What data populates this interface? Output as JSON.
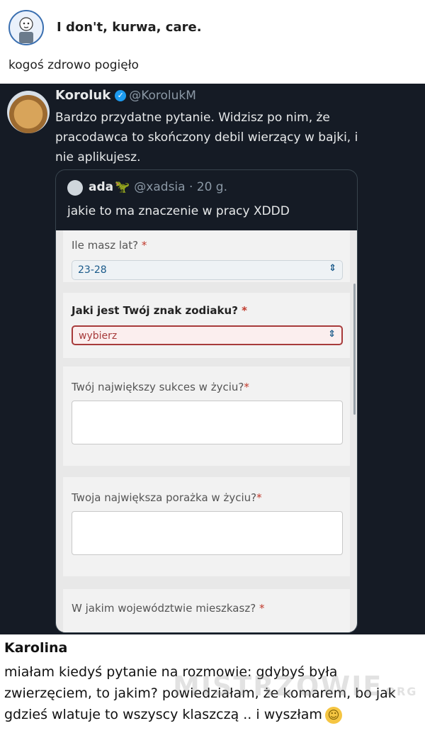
{
  "post": {
    "author": "I don't, kurwa, care.",
    "caption": "kogoś zdrowo pogięło"
  },
  "tweet": {
    "name": "Koroluk",
    "handle": "@KorolukM",
    "text": "Bardzo przydatne pytanie. Widzisz po nim, że pracodawca to skończony debil wierzący w bajki, i nie aplikujesz.",
    "quote": {
      "name": "ada",
      "handle": "@xadsia · 20 g.",
      "text": "jakie to ma znaczenie w pracy XDDD"
    }
  },
  "form": {
    "q1": {
      "label": "Ile masz lat?",
      "req": "*",
      "value": "23-28"
    },
    "q2": {
      "label": "Jaki jest Twój znak zodiaku?",
      "req": "*",
      "value": "wybierz"
    },
    "q3": {
      "label": "Twój największy sukces w życiu?",
      "req": "*"
    },
    "q4": {
      "label": "Twoja największa porażka w życiu?",
      "req": "*"
    },
    "q5": {
      "label": "W jakim województwie mieszkasz?",
      "req": "*"
    }
  },
  "comment": {
    "author": "Karolina",
    "text": "miałam kiedyś pytanie na rozmowie: gdybyś była zwierzęciem, to jakim? powiedziałam, że komarem, bo jak gdzieś wlatuje to wszyscy klaszczą .. i wyszłam"
  },
  "watermark": {
    "main": "MISTRZOWIE",
    "suffix": "ORG"
  },
  "icons": {
    "verified": "verified-badge-icon",
    "chevron": "chevron-updown-icon",
    "smiley": "smiley-icon"
  },
  "colors": {
    "tweet_bg": "#151b25",
    "verified": "#1d9bf0",
    "error": "#a73b3b",
    "link": "#1a5a8a"
  }
}
